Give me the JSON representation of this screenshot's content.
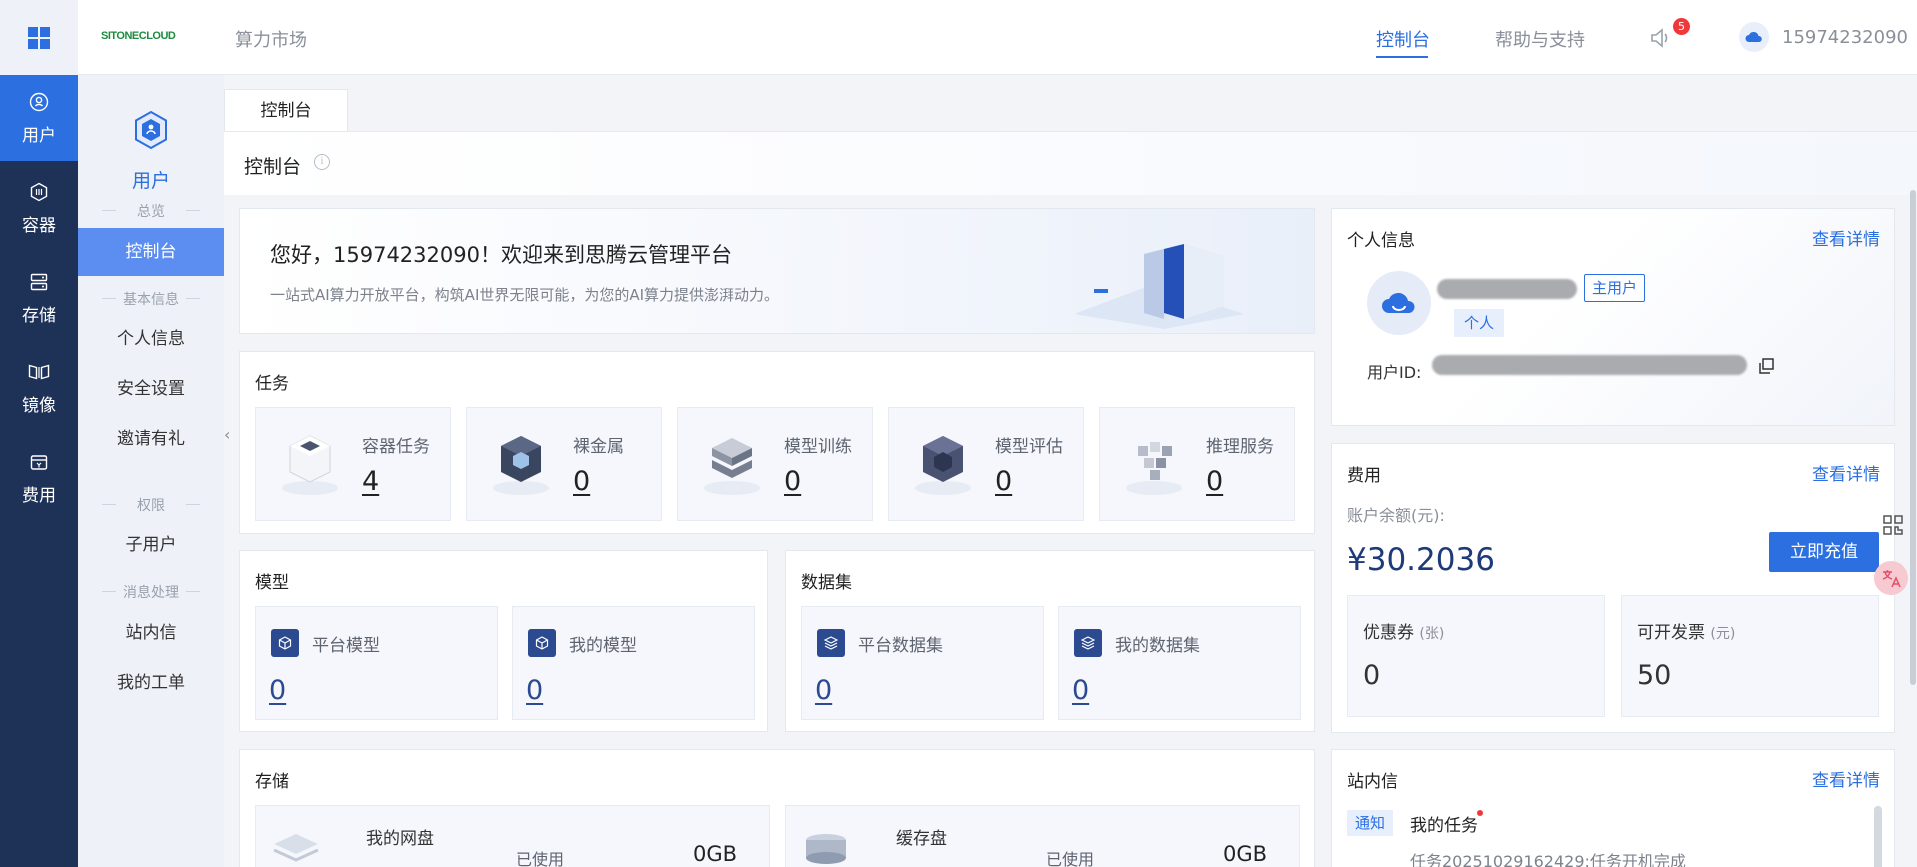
{
  "header": {
    "brand": "SITONECLOUD",
    "market_label": "算力市场",
    "console_label": "控制台",
    "help_label": "帮助与支持",
    "notification_count": "5",
    "phone": "15974232090"
  },
  "rail": {
    "items": [
      {
        "label": "用户",
        "icon": "user-icon"
      },
      {
        "label": "容器",
        "icon": "container-icon"
      },
      {
        "label": "存储",
        "icon": "storage-icon"
      },
      {
        "label": "镜像",
        "icon": "image-icon"
      },
      {
        "label": "费用",
        "icon": "billing-icon"
      }
    ]
  },
  "sidebar": {
    "hero_label": "用户",
    "groups": {
      "overview": "总览",
      "basic": "基本信息",
      "permissions": "权限",
      "messages": "消息处理"
    },
    "items": {
      "console": "控制台",
      "profile": "个人信息",
      "security": "安全设置",
      "invite": "邀请有礼",
      "subuser": "子用户",
      "inbox": "站内信",
      "tickets": "我的工单"
    }
  },
  "tab": {
    "label": "控制台"
  },
  "page": {
    "title": "控制台"
  },
  "welcome": {
    "title": "您好，15974232090！欢迎来到思腾云管理平台",
    "subtitle": "一站式AI算力开放平台，构筑AI世界无限可能，为您的AI算力提供澎湃动力。"
  },
  "tasks": {
    "title": "任务",
    "items": [
      {
        "label": "容器任务",
        "value": "4"
      },
      {
        "label": "裸金属",
        "value": "0"
      },
      {
        "label": "模型训练",
        "value": "0"
      },
      {
        "label": "模型评估",
        "value": "0"
      },
      {
        "label": "推理服务",
        "value": "0"
      }
    ]
  },
  "models": {
    "title": "模型",
    "items": [
      {
        "label": "平台模型",
        "value": "0"
      },
      {
        "label": "我的模型",
        "value": "0"
      }
    ]
  },
  "datasets": {
    "title": "数据集",
    "items": [
      {
        "label": "平台数据集",
        "value": "0"
      },
      {
        "label": "我的数据集",
        "value": "0"
      }
    ]
  },
  "storage": {
    "title": "存储",
    "items": [
      {
        "label": "我的网盘",
        "used_label": "已使用",
        "value": "0GB"
      },
      {
        "label": "缓存盘",
        "used_label": "已使用",
        "value": "0GB"
      }
    ]
  },
  "profile": {
    "title": "个人信息",
    "link": "查看详情",
    "badge_main": "主用户",
    "badge_type": "个人",
    "uid_label": "用户ID:"
  },
  "fees": {
    "title": "费用",
    "link": "查看详情",
    "balance_label": "账户余额(元):",
    "balance": "¥30.2036",
    "recharge_label": "立即充值",
    "coupon_label": "优惠券",
    "coupon_unit": "(张)",
    "coupon_value": "0",
    "invoice_label": "可开发票",
    "invoice_unit": "(元)",
    "invoice_value": "50"
  },
  "inbox": {
    "title": "站内信",
    "link": "查看详情",
    "tag": "通知",
    "item_title": "我的任务",
    "item_text": "任务20251029162429:任务开机完成"
  },
  "colors": {
    "primary": "#2b6fe0",
    "rail_bg": "#1e3258",
    "sidebar_active": "#5b8ef0",
    "badge_red": "#f0383b"
  }
}
